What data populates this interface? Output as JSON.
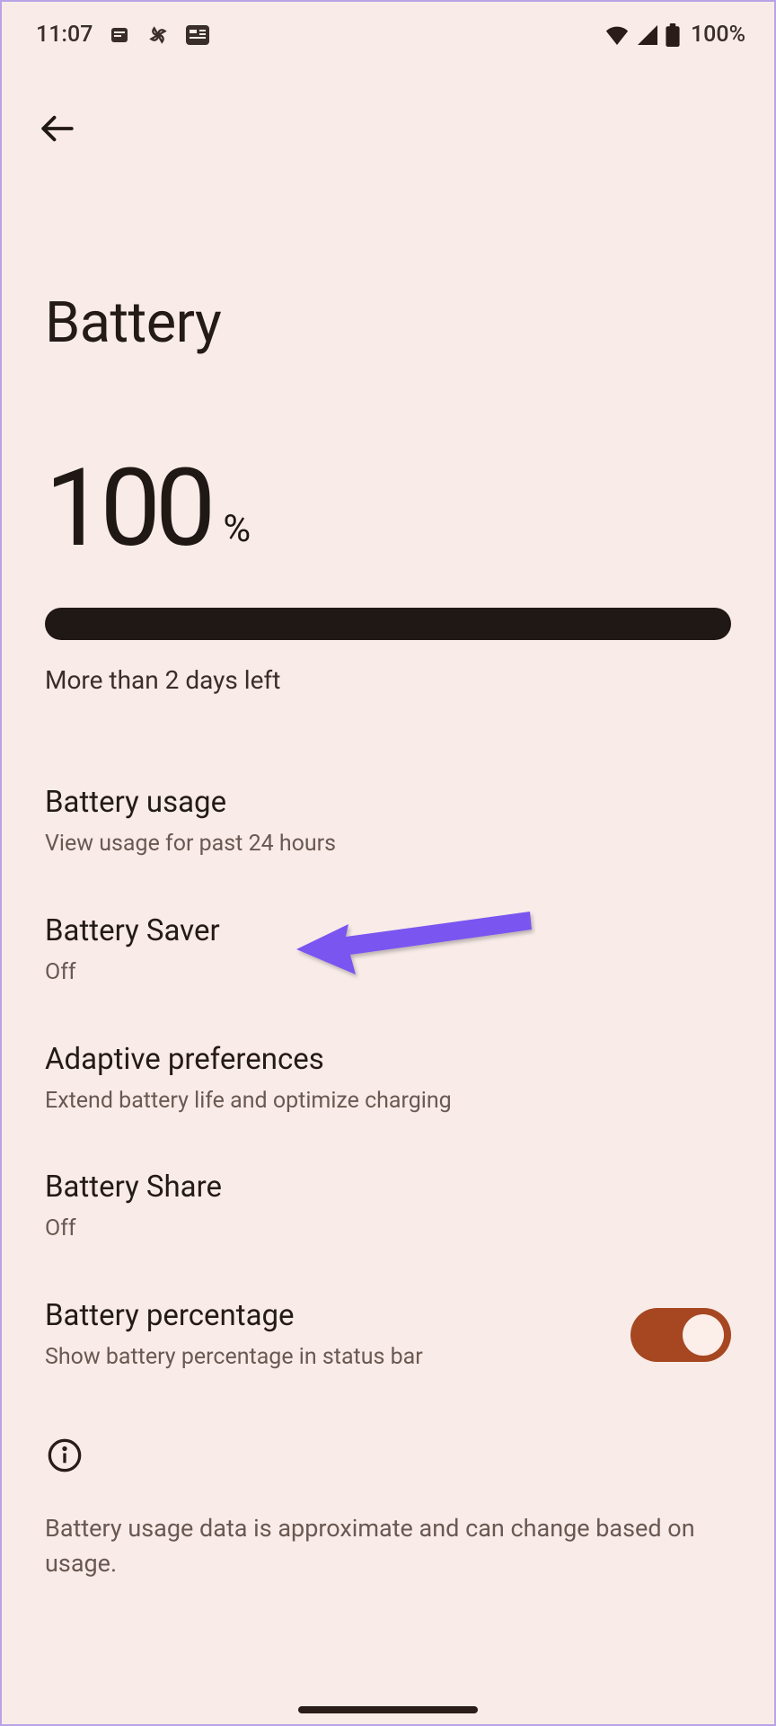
{
  "status_bar": {
    "time": "11:07",
    "battery_text": "100%"
  },
  "page": {
    "title": "Battery",
    "level": "100",
    "percent_symbol": "%",
    "estimate": "More than 2 days left"
  },
  "items": [
    {
      "title": "Battery usage",
      "sub": "View usage for past 24 hours"
    },
    {
      "title": "Battery Saver",
      "sub": "Off"
    },
    {
      "title": "Adaptive preferences",
      "sub": "Extend battery life and optimize charging"
    },
    {
      "title": "Battery Share",
      "sub": "Off"
    },
    {
      "title": "Battery percentage",
      "sub": "Show battery percentage in status bar"
    }
  ],
  "info": {
    "text": "Battery usage data is approximate and can change based on usage."
  }
}
